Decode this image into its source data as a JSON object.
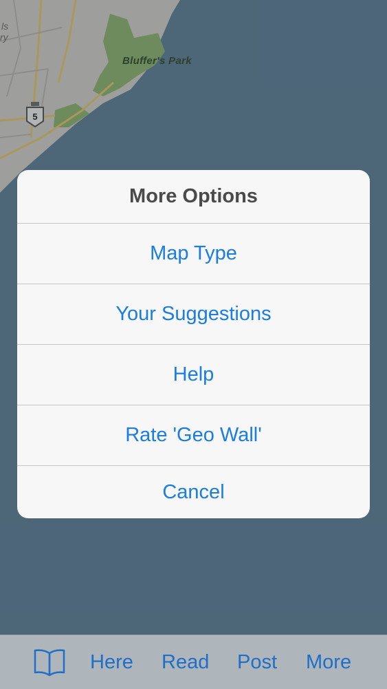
{
  "map": {
    "park_label": "Bluffer's Park",
    "route_number": "5",
    "partial_label_1": "ls",
    "partial_label_2": "ry"
  },
  "dialog": {
    "title": "More Options",
    "options": [
      {
        "label": "Map Type"
      },
      {
        "label": "Your Suggestions"
      },
      {
        "label": "Help"
      },
      {
        "label": "Rate 'Geo Wall'"
      },
      {
        "label": "Cancel"
      }
    ]
  },
  "tabbar": {
    "book_icon": "book-icon",
    "here": "Here",
    "read": "Read",
    "post": "Post",
    "more": "More"
  },
  "colors": {
    "water": "#5f7f96",
    "accent": "#1a7de0",
    "tab_text": "#1f6fc6",
    "park": "#8fb56f",
    "land": "#d6d3cb"
  }
}
